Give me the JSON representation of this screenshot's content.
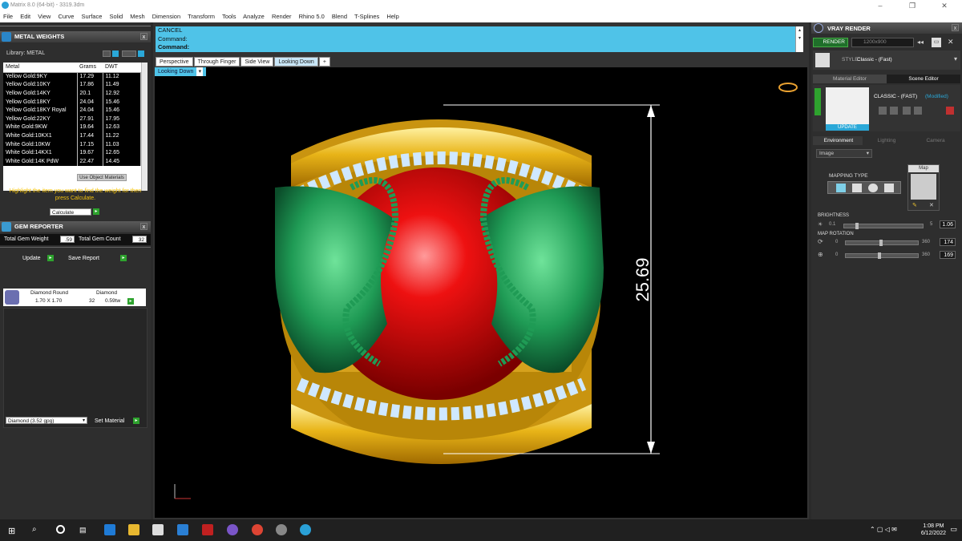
{
  "window": {
    "title": "Matrix 8.0 (64-bit) - 3319.3dm"
  },
  "menu": [
    "File",
    "Edit",
    "View",
    "Curve",
    "Surface",
    "Solid",
    "Mesh",
    "Dimension",
    "Transform",
    "Tools",
    "Analyze",
    "Render",
    "Rhino 5.0",
    "Blend",
    "T-Splines",
    "Help"
  ],
  "metal_weights": {
    "title": "METAL WEIGHTS",
    "library_label": "Library: METAL",
    "columns": [
      "Metal",
      "Grams",
      "DWT"
    ],
    "rows": [
      [
        "Yellow Gold:9KY",
        "17.29",
        "11.12"
      ],
      [
        "Yellow Gold:10KY",
        "17.86",
        "11.49"
      ],
      [
        "Yellow Gold:14KY",
        "20.1",
        "12.92"
      ],
      [
        "Yellow Gold:18KY",
        "24.04",
        "15.46"
      ],
      [
        "Yellow Gold:18KY Royal",
        "24.04",
        "15.46"
      ],
      [
        "Yellow Gold:22KY",
        "27.91",
        "17.95"
      ],
      [
        "White Gold:9KW",
        "19.64",
        "12.63"
      ],
      [
        "White Gold:10KX1",
        "17.44",
        "11.22"
      ],
      [
        "White Gold:10KW",
        "17.15",
        "11.03"
      ],
      [
        "White Gold:14KX1",
        "19.67",
        "12.65"
      ],
      [
        "White Gold:14K PdW",
        "22.47",
        "14.45"
      ]
    ],
    "use_object_materials": "Use Object Materials",
    "hint": "Highlight the item you want to find the weight for then press Calculate.",
    "calculate": "Calculate"
  },
  "gem_reporter": {
    "title": "GEM REPORTER",
    "total_gem_weight_label": "Total Gem Weight",
    "total_gem_weight": ".59",
    "total_gem_count_label": "Total Gem Count",
    "total_gem_count": "32",
    "update": "Update",
    "save_report": "Save Report",
    "gem": {
      "name": "Diamond Round",
      "size": "1.70 X 1.70",
      "material": "Diamond",
      "count": "32",
      "weight": "0.59tw"
    },
    "material_select": "Diamond   (3.52 gpg)",
    "set_material": "Set Material"
  },
  "command": {
    "lines": [
      "CANCEL",
      "Command:",
      "Command:"
    ]
  },
  "view_tabs": [
    "Perspective",
    "Through Finger",
    "Side View",
    "Looking Down"
  ],
  "active_view": "Looking Down",
  "viewport": {
    "dimension_label": "25.69"
  },
  "vray": {
    "title": "VRAY RENDER",
    "render": "RENDER",
    "resolution": "1200x900",
    "style_label": "STYLE:",
    "style_value": "Classic - (Fast)",
    "tabs": [
      "Material Editor",
      "Scene Editor"
    ],
    "preset_name": "CLASSIC - (FAST)",
    "preset_state": "(Modified)",
    "update": "UPDATE",
    "env_tabs": [
      "Environment",
      "Lighting",
      "Camera"
    ],
    "env_select": "Image",
    "mapping_type": "MAPPING TYPE",
    "map_label": "Map",
    "brightness_label": "BRIGHTNESS",
    "brightness_min": "0.1",
    "brightness_max": "5",
    "brightness_value": "1.06",
    "map_rotation_label": "MAP ROTATION",
    "rot1_min": "0",
    "rot1_max": "360",
    "rot1_value": "174",
    "rot2_min": "0",
    "rot2_max": "360",
    "rot2_value": "169"
  },
  "taskbar": {
    "time": "1:08 PM",
    "date": "6/12/2022"
  }
}
